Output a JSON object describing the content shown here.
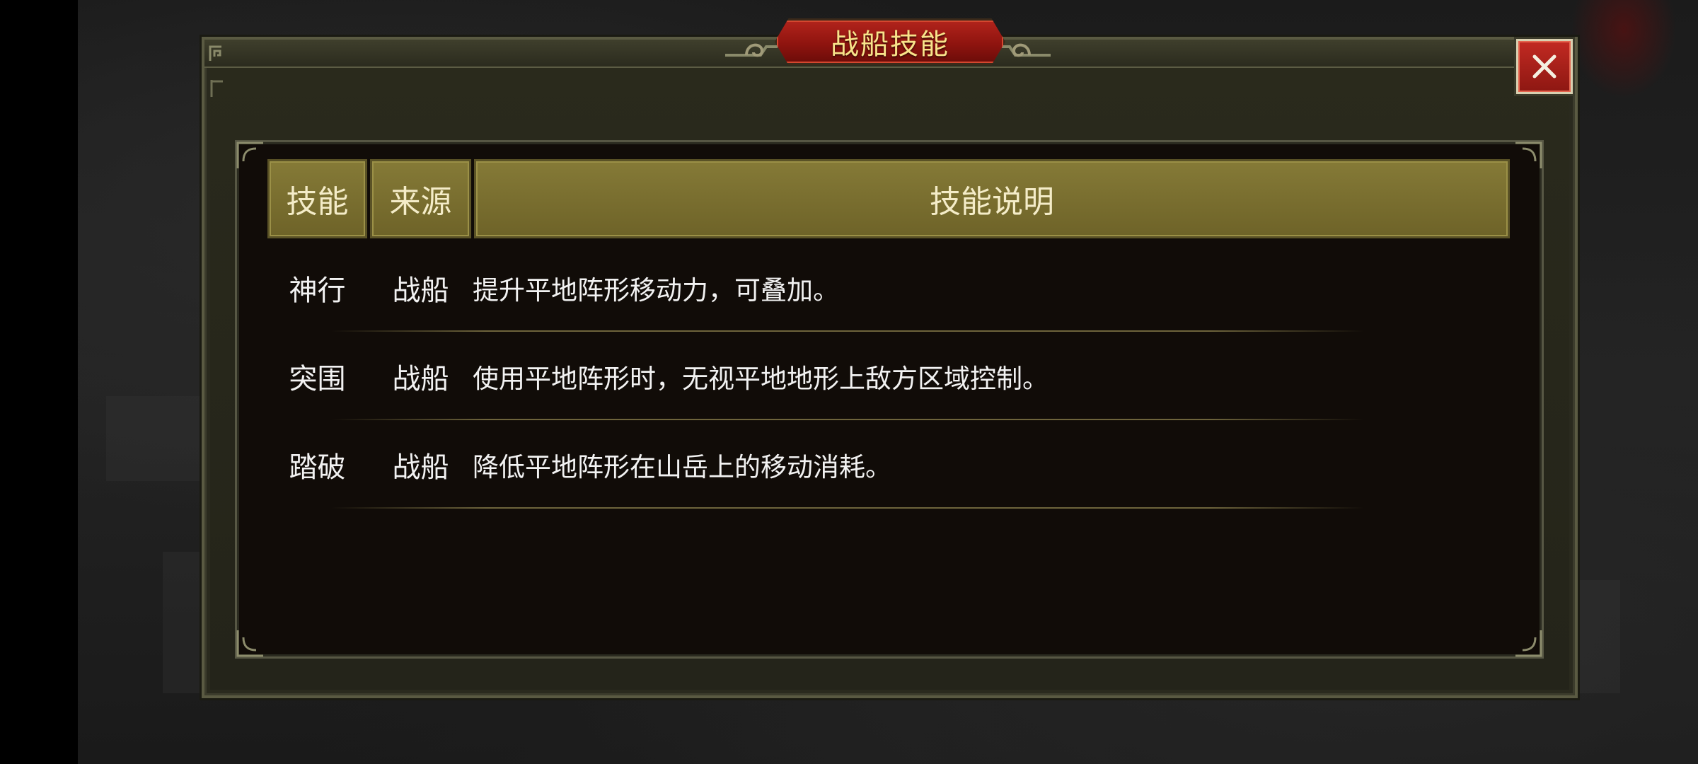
{
  "dialog": {
    "title": "战船技能",
    "close_icon": "close-x-icon"
  },
  "table": {
    "headers": {
      "skill": "技能",
      "source": "来源",
      "description": "技能说明"
    },
    "rows": [
      {
        "skill": "神行",
        "source": "战船",
        "description": "提升平地阵形移动力，可叠加。"
      },
      {
        "skill": "突围",
        "source": "战船",
        "description": "使用平地阵形时，无视平地地形上敌方区域控制。"
      },
      {
        "skill": "踏破",
        "source": "战船",
        "description": "降低平地阵形在山岳上的移动消耗。"
      }
    ]
  },
  "colors": {
    "title_plate": "#8f140f",
    "title_text": "#f8e38a",
    "header_fill": "#857a37",
    "panel_bg": "#110c08",
    "close_button": "#c22a22"
  }
}
